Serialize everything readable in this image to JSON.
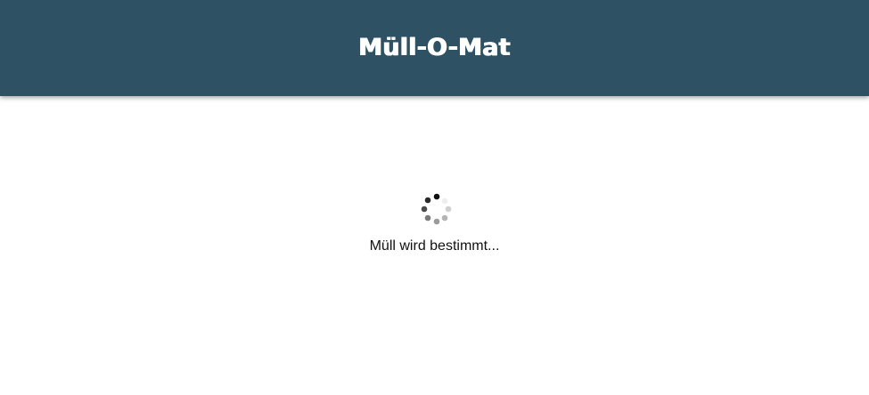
{
  "header": {
    "title": "Müll-O-Mat",
    "background_color": "#2f5164",
    "text_color": "#ffffff"
  },
  "loader": {
    "icon": "loading-spinner-icon",
    "status_text": "Müll wird bestimmt..."
  }
}
